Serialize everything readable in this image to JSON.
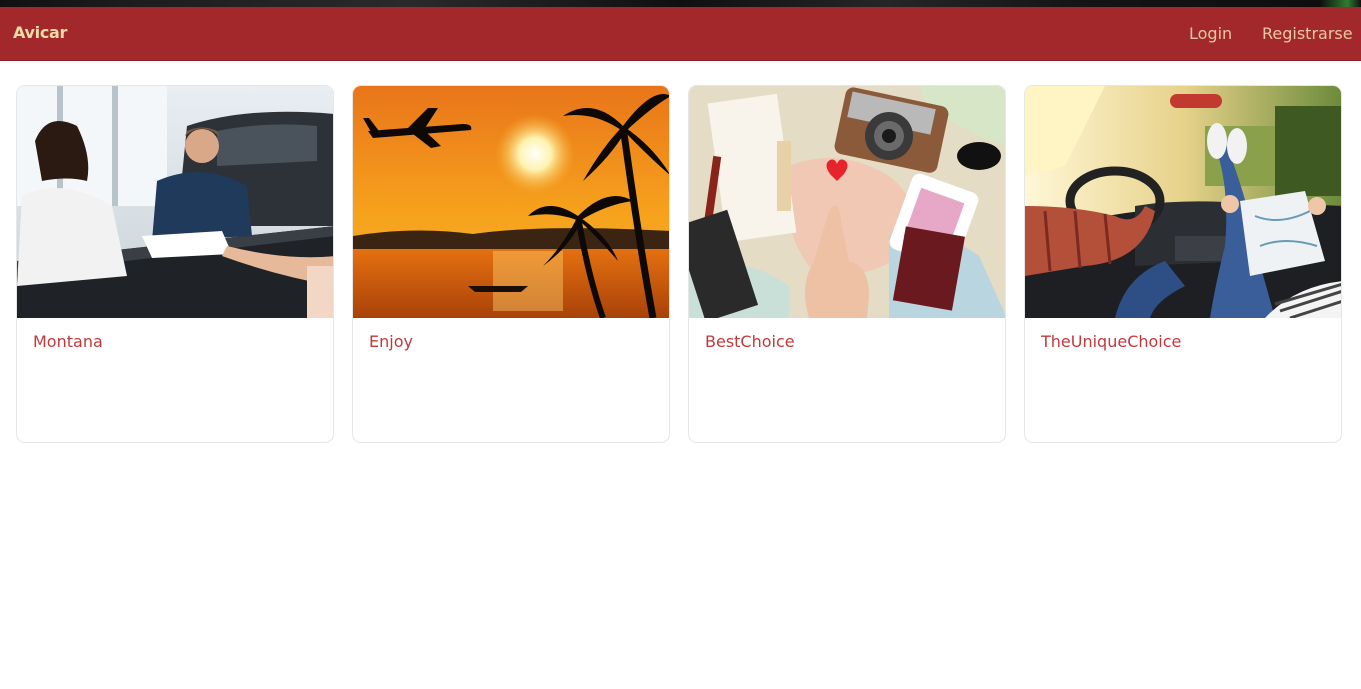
{
  "navbar": {
    "brand": "Avicar",
    "links": [
      "Login",
      "Registrarse"
    ]
  },
  "colors": {
    "navbar_bg": "#a3282b",
    "brand_text": "#f3dca8",
    "link_text": "#e9c9a4",
    "card_title": "#c0393b"
  },
  "cards": [
    {
      "title": "Montana",
      "image": "car-dealership-handshake-photo"
    },
    {
      "title": "Enjoy",
      "image": "tropical-sunset-airplane-photo"
    },
    {
      "title": "BestChoice",
      "image": "travel-map-camera-photo"
    },
    {
      "title": "TheUniqueChoice",
      "image": "road-trip-car-interior-photo"
    }
  ]
}
